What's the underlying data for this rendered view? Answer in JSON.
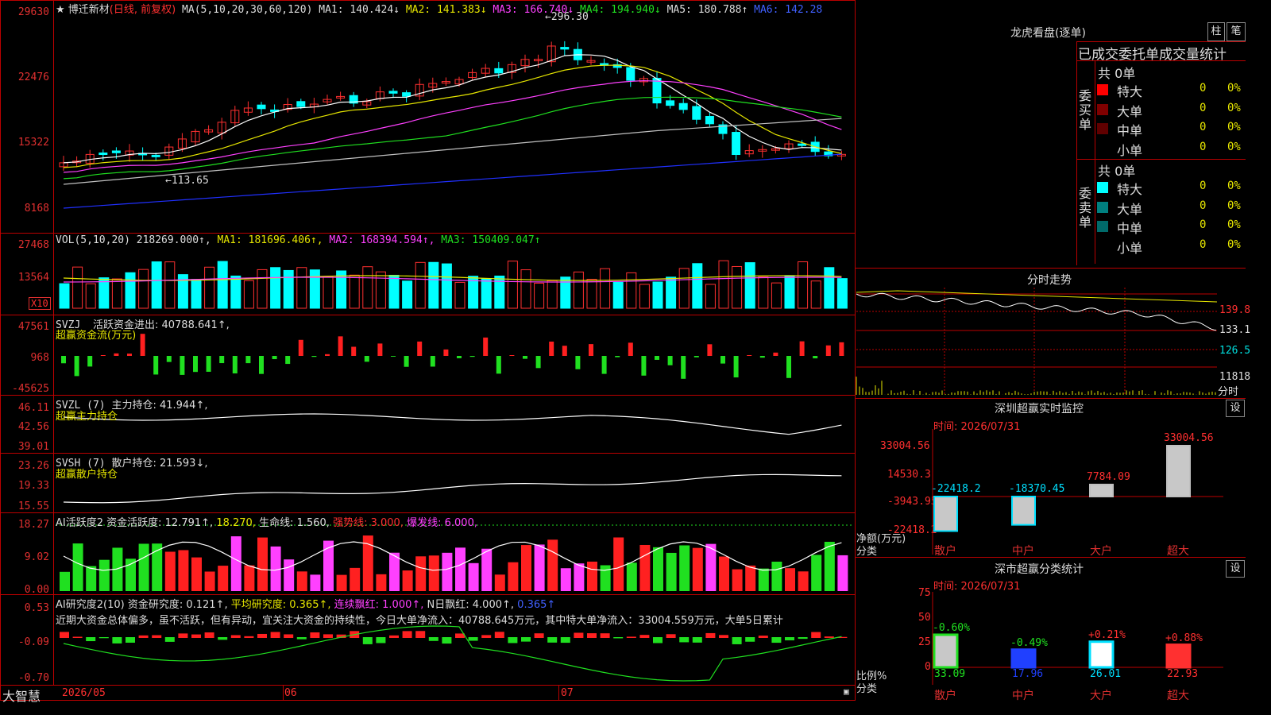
{
  "stock": {
    "name": "★ 博迁新材",
    "mode": "(日线, 前复权)"
  },
  "ma_header": {
    "label": "MA(5,10,20,30,60,120)",
    "ma1": "MA1: 140.424↓",
    "ma2": "MA2: 141.383↓",
    "ma3": "MA3: 166.740↓",
    "ma4": "MA4: 194.940↓",
    "ma5": "MA5: 180.788↑",
    "ma6": "MA6: 142.28"
  },
  "price_axis": [
    "29630",
    "22476",
    "15322",
    "8168"
  ],
  "annotations": {
    "high": "296.30",
    "low": "113.65"
  },
  "vol": {
    "header": "VOL(5,10,20)",
    "value": "218269.000↑,",
    "ma1": "MA1: 181696.406↑,",
    "ma2": "MA2: 168394.594↑,",
    "ma3": "MA3: 150409.047↑",
    "axis": [
      "27468",
      "13564"
    ],
    "unit": "X10"
  },
  "svzj": {
    "header": "SVZJ",
    "label": "活跃资金进出: 40788.641↑,",
    "sub": "超赢资金流(万元)",
    "axis": [
      "47561",
      "968",
      "-45625"
    ]
  },
  "svzl": {
    "header": "SVZL (7)",
    "label": "主力持仓: 41.944↑,",
    "sub": "超赢主力持仓",
    "axis": [
      "46.11",
      "42.56",
      "39.01"
    ]
  },
  "svsh": {
    "header": "SVSH (7)",
    "label": "散户持仓: 21.593↓,",
    "sub": "超赢散户持仓",
    "axis": [
      "23.26",
      "19.33",
      "15.55"
    ]
  },
  "ai1": {
    "header": "AI活跃度2",
    "a": "资金活跃度: 12.791↑,",
    "b": "18.270,",
    "c": "生命线: 1.560,",
    "d": "强势线: 3.000,",
    "e": "爆发线: 6.000,",
    "axis": [
      "18.27",
      "9.02",
      "0.00"
    ]
  },
  "ai2": {
    "header": "AI研究度2(10)",
    "a": "资金研究度: 0.121↑,",
    "b": "平均研究度: 0.365↑,",
    "c": "连续飘红: 1.000↑,",
    "d": "N日飘红: 4.000↑,",
    "e": "0.365↑",
    "text": "近期大资金总体偏多，虽不活跃，但有异动，宜关注大资金的持续性，今日大单净流入：40788.645万元，其中特大单净流入：33004.559万元，大单5日累计",
    "axis": [
      "0.53",
      "-0.09",
      "-0.70"
    ]
  },
  "dates": {
    "d1": "2026/05",
    "d2": "06",
    "d3": "07"
  },
  "brand": "大智慧",
  "right_top": {
    "title": "龙虎看盘(逐单)",
    "btn1": "柱",
    "btn2": "笔",
    "subtitle": "已成交委托单成交量统计",
    "buy_label": "委买单",
    "sell_label": "委卖单",
    "buy_total": "共 0单",
    "sell_total": "共 0单",
    "buy": [
      {
        "k": "特大",
        "v": "0",
        "p": "0%"
      },
      {
        "k": "大单",
        "v": "0",
        "p": "0%"
      },
      {
        "k": "中单",
        "v": "0",
        "p": "0%"
      },
      {
        "k": "小单",
        "v": "0",
        "p": "0%"
      }
    ],
    "sell": [
      {
        "k": "特大",
        "v": "0",
        "p": "0%"
      },
      {
        "k": "大单",
        "v": "0",
        "p": "0%"
      },
      {
        "k": "中单",
        "v": "0",
        "p": "0%"
      },
      {
        "k": "小单",
        "v": "0",
        "p": "0%"
      }
    ]
  },
  "intraday": {
    "title": "分时走势",
    "axis": [
      "139.8",
      "133.1",
      "126.5"
    ],
    "vol": "11818",
    "unit": "分时"
  },
  "sz_monitor": {
    "title": "深圳超赢实时监控",
    "btn": "设",
    "time": "时间: 2026/07/31",
    "axis": [
      "33004.56",
      "14530.3",
      "-3943.95",
      "-22418.2"
    ],
    "ylabel": "净额(万元)",
    "xlabel": "分类",
    "cats": [
      "散户",
      "中户",
      "大户",
      "超大"
    ],
    "values": [
      "-22418.2",
      "-18370.45",
      "7784.09",
      "33004.56"
    ]
  },
  "sz_class": {
    "title": "深市超赢分类统计",
    "btn": "设",
    "time": "时间: 2026/07/31",
    "axis": [
      "75",
      "50",
      "25",
      "0"
    ],
    "ylabel": "比例%",
    "xlabel": "分类",
    "cats": [
      "散户",
      "中户",
      "大户",
      "超大"
    ],
    "pct": [
      "-0.60%",
      "-0.49%",
      "+0.21%",
      "+0.88%"
    ],
    "values": [
      "33.09",
      "17.96",
      "26.01",
      "22.93"
    ]
  },
  "chart_data": {
    "type": "bar",
    "title": "深圳超赢实时监控",
    "ylabel": "净额(万元)",
    "categories": [
      "散户",
      "中户",
      "大户",
      "超大"
    ],
    "values": [
      -22418.2,
      -18370.45,
      7784.09,
      33004.56
    ]
  }
}
